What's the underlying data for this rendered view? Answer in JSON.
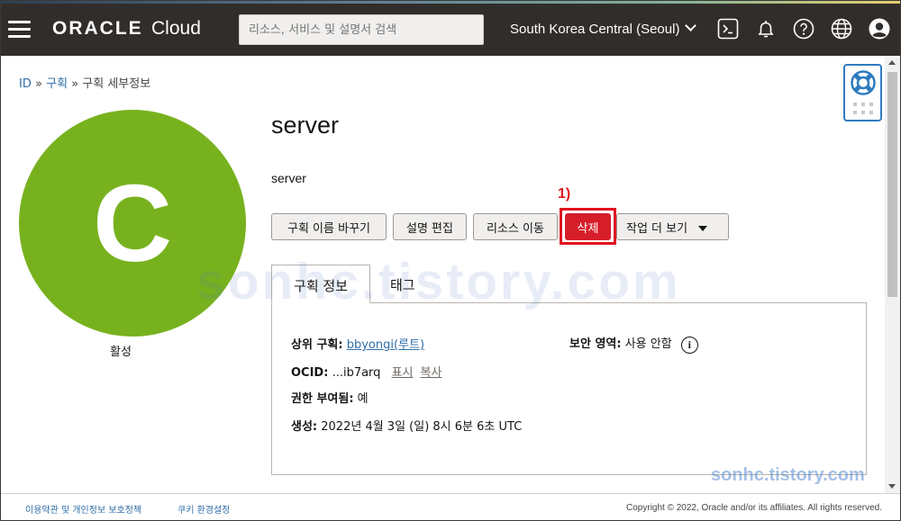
{
  "header": {
    "logo_brand": "ORACLE",
    "logo_product": "Cloud",
    "search_placeholder": "리소스, 서비스 및 설명서 검색",
    "region": "South Korea Central (Seoul)"
  },
  "breadcrumb": {
    "root": "ID",
    "sep1": "»",
    "parent": "구획",
    "sep2": "»",
    "current": "구획 세부정보"
  },
  "avatar": {
    "letter": "C",
    "status": "활성",
    "color": "#77b21e"
  },
  "compartment": {
    "name": "server",
    "description": "server"
  },
  "annotation": "1)",
  "actions": {
    "rename": "구획 이름 바꾸기",
    "edit_desc": "설명 편집",
    "move": "리소스 이동",
    "delete": "삭제",
    "more": "작업 더 보기"
  },
  "tabs": {
    "info": "구획 정보",
    "tags": "태그"
  },
  "info": {
    "parent_label": "상위 구획:",
    "parent_value": "bbyongi(루트)",
    "ocid_label": "OCID:",
    "ocid_value": "...ib7arq",
    "ocid_show": "표시",
    "ocid_copy": "복사",
    "authorized_label": "권한 부여됨:",
    "authorized_value": "예",
    "created_label": "생성:",
    "created_value": "2022년 4월 3일 (일) 8시 6분 6초 UTC",
    "security_zone_label": "보안 영역:",
    "security_zone_value": "사용 안함"
  },
  "footer": {
    "terms": "이용약관 및 개인정보 보호정책",
    "cookies": "쿠키 환경설정",
    "copyright": "Copyright © 2022, Oracle and/or its affiliates. All rights reserved."
  },
  "watermark": "sonhc.tistory.com",
  "colors": {
    "header_bg": "#312d2a",
    "link": "#2f6ea8",
    "delete": "#d61e2a",
    "highlight": "#e0141e"
  },
  "icons": [
    "menu-icon",
    "cloud-shell-icon",
    "bell-icon",
    "help-icon",
    "globe-icon",
    "user-icon",
    "lifebuoy-icon",
    "grid-icon",
    "info-icon",
    "chevron-down-icon",
    "caret-down-icon"
  ]
}
